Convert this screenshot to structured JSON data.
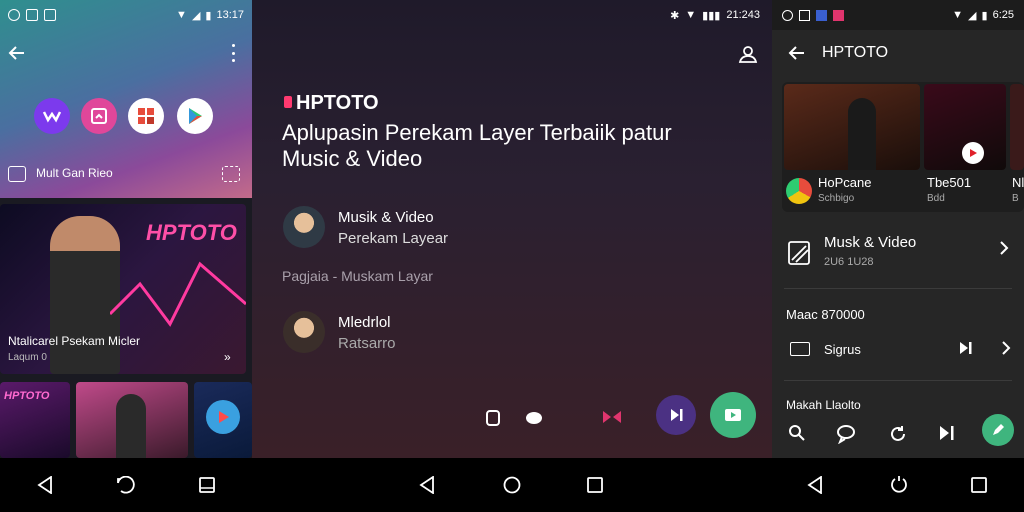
{
  "panel1": {
    "status_time": "13:17",
    "media_label": "Mult Gan Rieo",
    "hero_title": "HPTOTO",
    "hero_caption": "Ntalicarel Psekam Micler",
    "hero_subcaption": "Laqum 0",
    "thumb1_text": "HPTOTO"
  },
  "panel2": {
    "status_time": "21:243",
    "brand": "HPTOTO",
    "headline": "Aplupasin Perekam Layer Terbaiik patur Music & Video",
    "item1_line1": "Musik & Video",
    "item1_line2": "Perekam Layear",
    "section_label": "Pagjaia - Muskam Layar",
    "item2_line1": "Mledrlol",
    "item2_line2": "Ratsarro"
  },
  "panel3": {
    "status_time": "6:25",
    "title": "HPTOTO",
    "card1_title": "HoPcane",
    "card1_sub": "Schbigo",
    "card2_title": "Tbe501",
    "card2_sub": "Bdd",
    "card3_title": "Nl",
    "card3_sub": "B",
    "row1_title": "Musk & Video",
    "row1_sub": "2U6 1U28",
    "section_label": "Maac 870000",
    "row2_title": "Sigrus",
    "row3_title": "Makah Llaolto"
  },
  "colors": {
    "panel1_header": "#3f8f8f",
    "panel3_bg": "#262626",
    "accent_green": "#3fb57e",
    "accent_purple": "#4b3183"
  }
}
